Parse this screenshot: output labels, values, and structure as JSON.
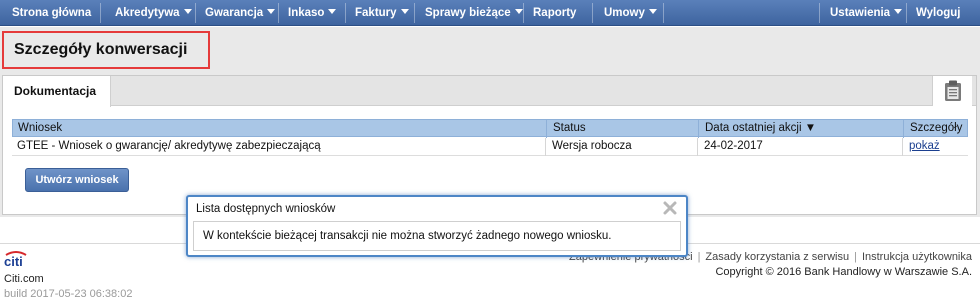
{
  "nav": {
    "items": [
      {
        "label": "Strona główna",
        "dropdown": false
      },
      {
        "label": "Akredytywa",
        "dropdown": true
      },
      {
        "label": "Gwarancja",
        "dropdown": true
      },
      {
        "label": "Inkaso",
        "dropdown": true
      },
      {
        "label": "Faktury",
        "dropdown": true
      },
      {
        "label": "Sprawy bieżące",
        "dropdown": true
      },
      {
        "label": "Raporty",
        "dropdown": false
      },
      {
        "label": "Umowy",
        "dropdown": true
      }
    ],
    "right_items": [
      {
        "label": "Ustawienia",
        "dropdown": true
      },
      {
        "label": "Wyloguj",
        "dropdown": false
      }
    ]
  },
  "page": {
    "title": "Szczegóły konwersacji"
  },
  "tabs": {
    "active": "Dokumentacja",
    "clipboard_icon": "clipboard-icon"
  },
  "table": {
    "columns": [
      "Wniosek",
      "Status",
      "Data ostatniej akcji ▼",
      "Szczegóły"
    ],
    "rows": [
      {
        "wniosek": "GTEE - Wniosek o gwarancję/ akredytywę zabezpieczającą",
        "status": "Wersja robocza",
        "date": "24-02-2017",
        "details": "pokaż"
      }
    ]
  },
  "buttons": {
    "create": "Utwórz wniosek"
  },
  "dialog": {
    "title": "Lista dostępnych wniosków",
    "message": "W kontekście bieżącej transakcji nie można stworzyć żadnego nowego wniosku."
  },
  "footer": {
    "brand": "citi",
    "site": "Citi.com",
    "build": "build 2017-05-23 06:38:02",
    "links": [
      "Zapewnienie prywatności",
      "Zasady korzystania z serwisu",
      "Instrukcja użytkownika"
    ],
    "copyright": "Copyright © 2016 Bank Handlowy w Warszawie S.A."
  },
  "colors": {
    "nav": "#4a70ab",
    "table_header": "#a9c6e6",
    "highlight_border": "#e53a3a",
    "dialog_border": "#4d86c6"
  }
}
